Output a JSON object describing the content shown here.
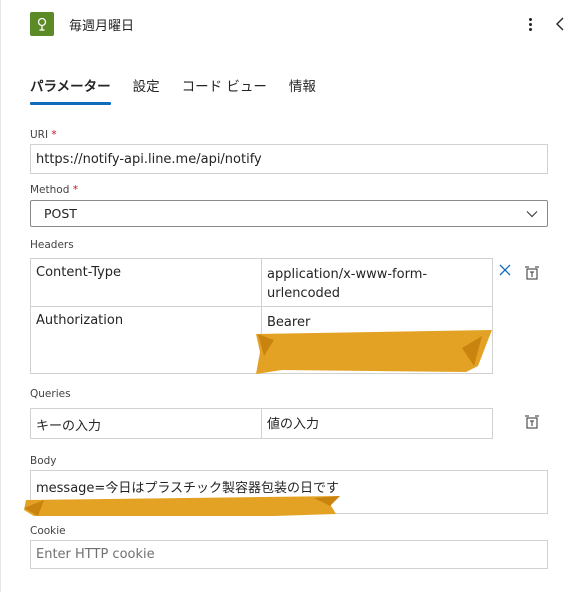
{
  "header": {
    "title": "毎週月曜日",
    "icon": "condition-flow-icon",
    "accent_color": "#5c8a27"
  },
  "tabs": [
    {
      "label": "パラメーター",
      "active": true
    },
    {
      "label": "設定",
      "active": false
    },
    {
      "label": "コード ビュー",
      "active": false
    },
    {
      "label": "情報",
      "active": false
    }
  ],
  "uri": {
    "label": "URI",
    "required_mark": "*",
    "value": "https://notify-api.line.me/api/notify"
  },
  "method": {
    "label": "Method",
    "required_mark": "*",
    "value": "POST"
  },
  "headers": {
    "label": "Headers",
    "rows": [
      {
        "key": "Content-Type",
        "value": "application/x-www-form-urlencoded"
      },
      {
        "key": "Authorization",
        "value": "Bearer"
      }
    ]
  },
  "queries": {
    "label": "Queries",
    "key_placeholder": "キーの入力",
    "value_placeholder": "値の入力"
  },
  "body": {
    "label": "Body",
    "value": "message=今日はプラスチック製容器包装の日です"
  },
  "cookie": {
    "label": "Cookie",
    "placeholder": "Enter HTTP cookie"
  },
  "colors": {
    "tab_indicator": "#0f6cbd",
    "remove_icon": "#0f6cbd",
    "required": "#c50f1f",
    "redaction": "#e3a224"
  }
}
